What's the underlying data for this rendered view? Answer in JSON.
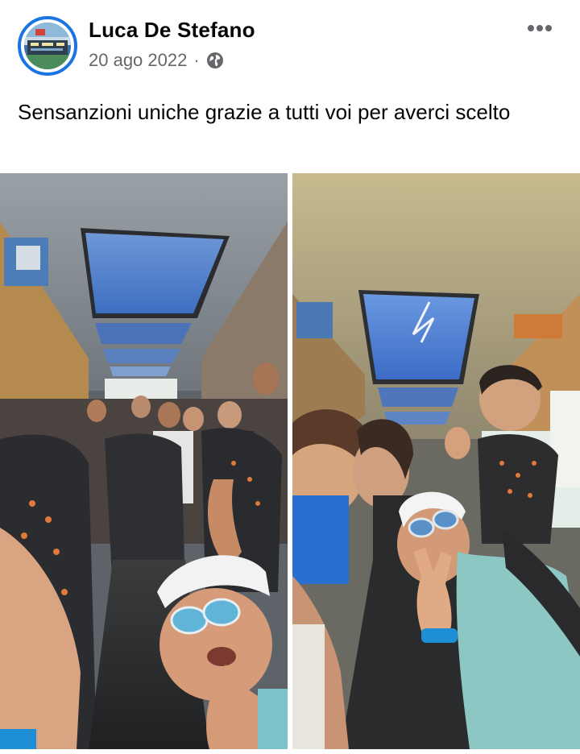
{
  "post": {
    "author": "Luca De Stefano",
    "date": "20 ago 2022",
    "separator": "·",
    "privacy_icon": "globe-icon",
    "more_icon": "more-horizontal-icon",
    "text": "Sensanzioni uniche grazie a tutti voi per averci scelto"
  },
  "photos": [
    {
      "name": "bus-selfie-left"
    },
    {
      "name": "bus-selfie-right"
    }
  ],
  "colors": {
    "avatar_ring": "#1b74e4",
    "meta_text": "#65676b",
    "primary_text": "#050505"
  }
}
